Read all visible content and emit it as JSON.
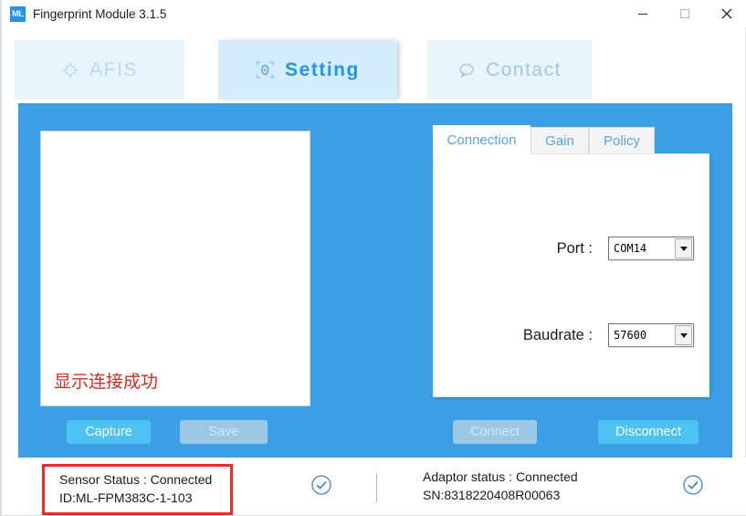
{
  "window": {
    "title": "Fingerprint Module 3.1.5",
    "app_icon": "ml-logo-icon",
    "accent_color": "#3d9fe5",
    "controls": {
      "minimize": "—",
      "maximize": "☐",
      "close": "✕"
    }
  },
  "nav": {
    "tabs": [
      {
        "label": "AFIS",
        "icon": "crosshair-target-icon",
        "active": false
      },
      {
        "label": "Setting",
        "icon": "fingerprint-scan-icon",
        "active": true
      },
      {
        "label": "Contact",
        "icon": "speech-bubble-icon",
        "active": false
      }
    ]
  },
  "preview": {
    "note": "显示连接成功",
    "note_color": "#d42a20"
  },
  "actions": {
    "capture": {
      "label": "Capture",
      "enabled": true
    },
    "save": {
      "label": "Save",
      "enabled": false
    },
    "connect": {
      "label": "Connect",
      "enabled": false
    },
    "disconnect": {
      "label": "Disconnect",
      "enabled": true
    }
  },
  "settings": {
    "tabs": [
      {
        "label": "Connection",
        "active": true
      },
      {
        "label": "Gain",
        "active": false
      },
      {
        "label": "Policy",
        "active": false
      }
    ],
    "fields": {
      "port": {
        "label": "Port :",
        "value": "COM14",
        "options": [
          "COM14"
        ]
      },
      "baudrate": {
        "label": "Baudrate :",
        "value": "57600",
        "options": [
          "57600"
        ]
      }
    }
  },
  "status": {
    "sensor": {
      "line1": "Sensor Status : Connected",
      "line2": "ID:ML-FPM383C-1-103",
      "badge": "check-circle-icon",
      "highlight_color": "#ef2b1e"
    },
    "adaptor": {
      "line1": "Adaptor status : Connected",
      "line2": "SN:8318220408R00063",
      "badge": "check-circle-icon"
    }
  }
}
